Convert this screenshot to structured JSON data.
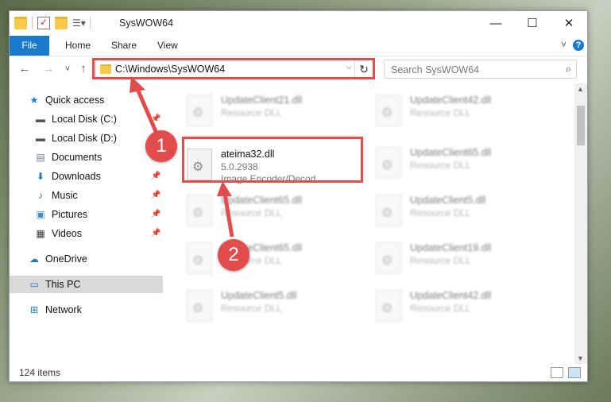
{
  "window": {
    "title": "SysWOW64",
    "controls": {
      "minimize": "—",
      "maximize": "☐",
      "close": "✕"
    }
  },
  "ribbon": {
    "tabs": [
      "File",
      "Home",
      "Share",
      "View"
    ],
    "help": "?"
  },
  "navigation": {
    "back": "←",
    "forward": "→",
    "recent": "˅",
    "up": "↑",
    "address": "C:\\Windows\\SysWOW64",
    "refresh": "↻",
    "search_placeholder": "Search SysWOW64"
  },
  "sidebar": {
    "items": [
      {
        "label": "Quick access",
        "icon": "star-icon",
        "pinned": false
      },
      {
        "label": "Local Disk (C:)",
        "icon": "drive-icon",
        "pinned": true
      },
      {
        "label": "Local Disk (D:)",
        "icon": "drive-icon",
        "pinned": true
      },
      {
        "label": "Documents",
        "icon": "documents-icon",
        "pinned": true
      },
      {
        "label": "Downloads",
        "icon": "download-icon",
        "pinned": true
      },
      {
        "label": "Music",
        "icon": "music-icon",
        "pinned": true
      },
      {
        "label": "Pictures",
        "icon": "pictures-icon",
        "pinned": true
      },
      {
        "label": "Videos",
        "icon": "videos-icon",
        "pinned": true
      },
      {
        "label": "OneDrive",
        "icon": "cloud-icon",
        "pinned": false
      },
      {
        "label": "This PC",
        "icon": "computer-icon",
        "pinned": false,
        "selected": true
      },
      {
        "label": "Network",
        "icon": "network-icon",
        "pinned": false
      }
    ]
  },
  "files": {
    "left": [
      {
        "name": "UpdateClient21.dll",
        "type": "Resource DLL"
      },
      {
        "name": "ateima32.dll",
        "version": "5.0.2938",
        "type": "Image Encoder/Decod...",
        "highlighted": true
      },
      {
        "name": "UpdateClient65.dll",
        "type": "Resource DLL"
      },
      {
        "name": "UpdateClient65.dll",
        "type": "Resource DLL"
      },
      {
        "name": "UpdateClient5.dll",
        "type": "Resource DLL"
      }
    ],
    "right": [
      {
        "name": "UpdateClient42.dll",
        "type": "Resource DLL"
      },
      {
        "name": "UpdateClient65.dll",
        "type": "Resource DLL"
      },
      {
        "name": "UpdateClient5.dll",
        "type": "Resource DLL"
      },
      {
        "name": "UpdateClient19.dll",
        "type": "Resource DLL"
      },
      {
        "name": "UpdateClient42.dll",
        "type": "Resource DLL"
      }
    ]
  },
  "status": {
    "item_count": "124 items"
  },
  "annotations": {
    "step1": "1",
    "step2": "2",
    "color": "#e34c4c"
  }
}
